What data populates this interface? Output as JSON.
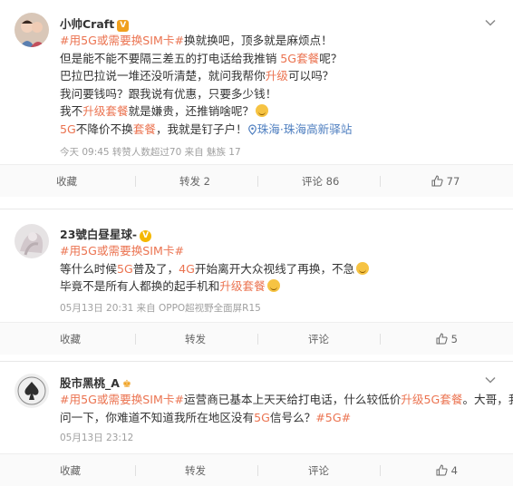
{
  "posts": [
    {
      "username": "小帅Craft",
      "lines": {
        "l1_tag": "#用5G或需要换SIM卡#",
        "l1_rest": "换就换吧，顶多就是麻烦点！",
        "l2_a": "但是能不能不要隔三差五的打电话给我推销 ",
        "l2_link": "5G套餐",
        "l2_b": "呢？",
        "l3_a": "巴拉巴拉说一堆还没听清楚，就问我帮你",
        "l3_link": "升级",
        "l3_b": "可以吗？",
        "l4": "我问要钱吗？跟我说有优惠，只要多少钱！",
        "l5_a": "我不",
        "l5_link": "升级套餐",
        "l5_b": "就是嫌贵，还推销啥呢？",
        "l6_link1": "5G",
        "l6_a": "不降价不换",
        "l6_link2": "套餐",
        "l6_b": "，我就是钉子户！",
        "l6_loc": "珠海·珠海高新驿站"
      },
      "meta": "今天 09:45 转赞人数超过70  来自 魅族 17",
      "actions": {
        "favorite": "收藏",
        "repost": "转发 2",
        "comment": "评论 86",
        "like": "77"
      }
    },
    {
      "username": "23號白昼星球-",
      "lines": {
        "l1_tag": "#用5G或需要换SIM卡#",
        "l2_a": "等什么时候",
        "l2_link1": "5G",
        "l2_b": "普及了，",
        "l2_link2": "4G",
        "l2_c": "开始离开大众视线了再换，不急",
        "l3_a": "毕竟不是所有人都换的起手机和",
        "l3_link": "升级套餐"
      },
      "meta": "05月13日 20:31 来自 OPPO超视野全面屏R15",
      "actions": {
        "favorite": "收藏",
        "repost": "转发",
        "comment": "评论",
        "like": "5"
      }
    },
    {
      "username": "股市黑桃_A",
      "lines": {
        "l1_tag": "#用5G或需要换SIM卡#",
        "l1_a": "运营商已基本上天天给打电话，什么较低价",
        "l1_link": "升级5G套餐",
        "l1_b": "。大哥，我想",
        "l2_a": "问一下，你难道不知道我所在地区没有",
        "l2_link": "5G",
        "l2_b": "信号么？",
        "l2_tag": "#5G#"
      },
      "meta": "05月13日 23:12",
      "actions": {
        "favorite": "收藏",
        "repost": "转发",
        "comment": "评论",
        "like": "4"
      }
    }
  ]
}
